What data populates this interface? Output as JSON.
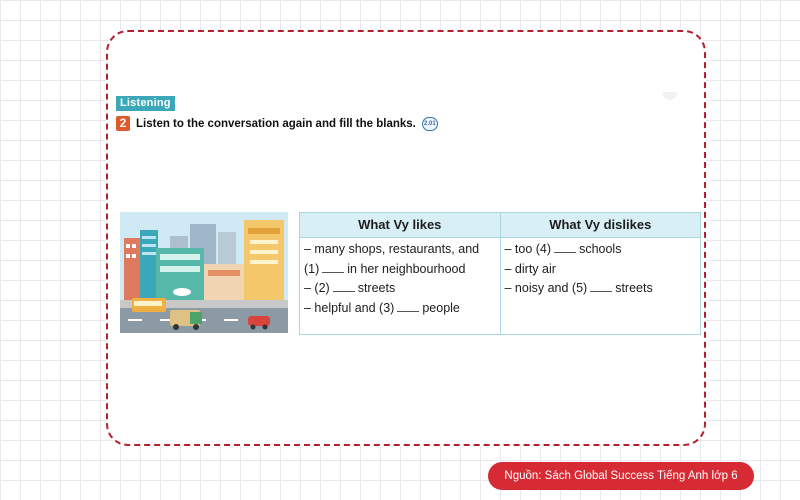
{
  "exercise": {
    "section_label": "Listening",
    "number": "2",
    "instruction": "Listen to the conversation again and fill the blanks.",
    "audio_track": "2.01"
  },
  "table": {
    "likes": {
      "header": "What Vy likes",
      "rows": [
        {
          "pre": "– many shops, restaurants, and (1)",
          "post": "in her neighbourhood"
        },
        {
          "pre": "– (2)",
          "post": "streets"
        },
        {
          "pre": "– helpful and (3)",
          "post": "people"
        }
      ]
    },
    "dislikes": {
      "header": "What Vy dislikes",
      "rows": [
        {
          "pre": "– too (4)",
          "post": "schools"
        },
        {
          "pre": "– dirty air",
          "post": ""
        },
        {
          "pre": "– noisy and (5)",
          "post": "streets"
        }
      ]
    }
  },
  "credit": "Nguồn: Sách Global Success Tiếng Anh lớp 6",
  "colors": {
    "card_border": "#b5202e",
    "section_tag": "#3aa8b8",
    "task_number": "#e05a2e",
    "table_header_bg": "#d9eff6",
    "credit_bg": "#d62b34"
  }
}
